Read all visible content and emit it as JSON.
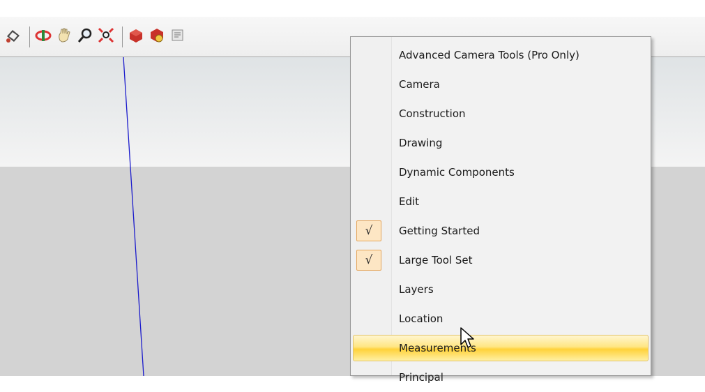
{
  "toolbar": {
    "icons": [
      "paint-bucket-icon",
      "orbit-icon",
      "pan-icon",
      "zoom-icon",
      "zoom-extents-icon",
      "get-models-icon",
      "share-model-icon",
      "extension-warehouse-icon"
    ]
  },
  "context_menu": {
    "items": [
      {
        "label": "Advanced Camera Tools (Pro Only)",
        "checked": false
      },
      {
        "label": "Camera",
        "checked": false
      },
      {
        "label": "Construction",
        "checked": false
      },
      {
        "label": "Drawing",
        "checked": false
      },
      {
        "label": "Dynamic Components",
        "checked": false
      },
      {
        "label": "Edit",
        "checked": false
      },
      {
        "label": "Getting Started",
        "checked": true
      },
      {
        "label": "Large Tool Set",
        "checked": true
      },
      {
        "label": "Layers",
        "checked": false
      },
      {
        "label": "Location",
        "checked": false
      },
      {
        "label": "Measurements",
        "checked": false,
        "hovered": true
      },
      {
        "label": "Principal",
        "checked": false
      }
    ],
    "check_glyph": "√"
  },
  "colors": {
    "axis_blue": "#1a1acc",
    "check_bg": "#fde6c4",
    "check_border": "#e5a55a",
    "hover_gold": "#ffd23a"
  }
}
